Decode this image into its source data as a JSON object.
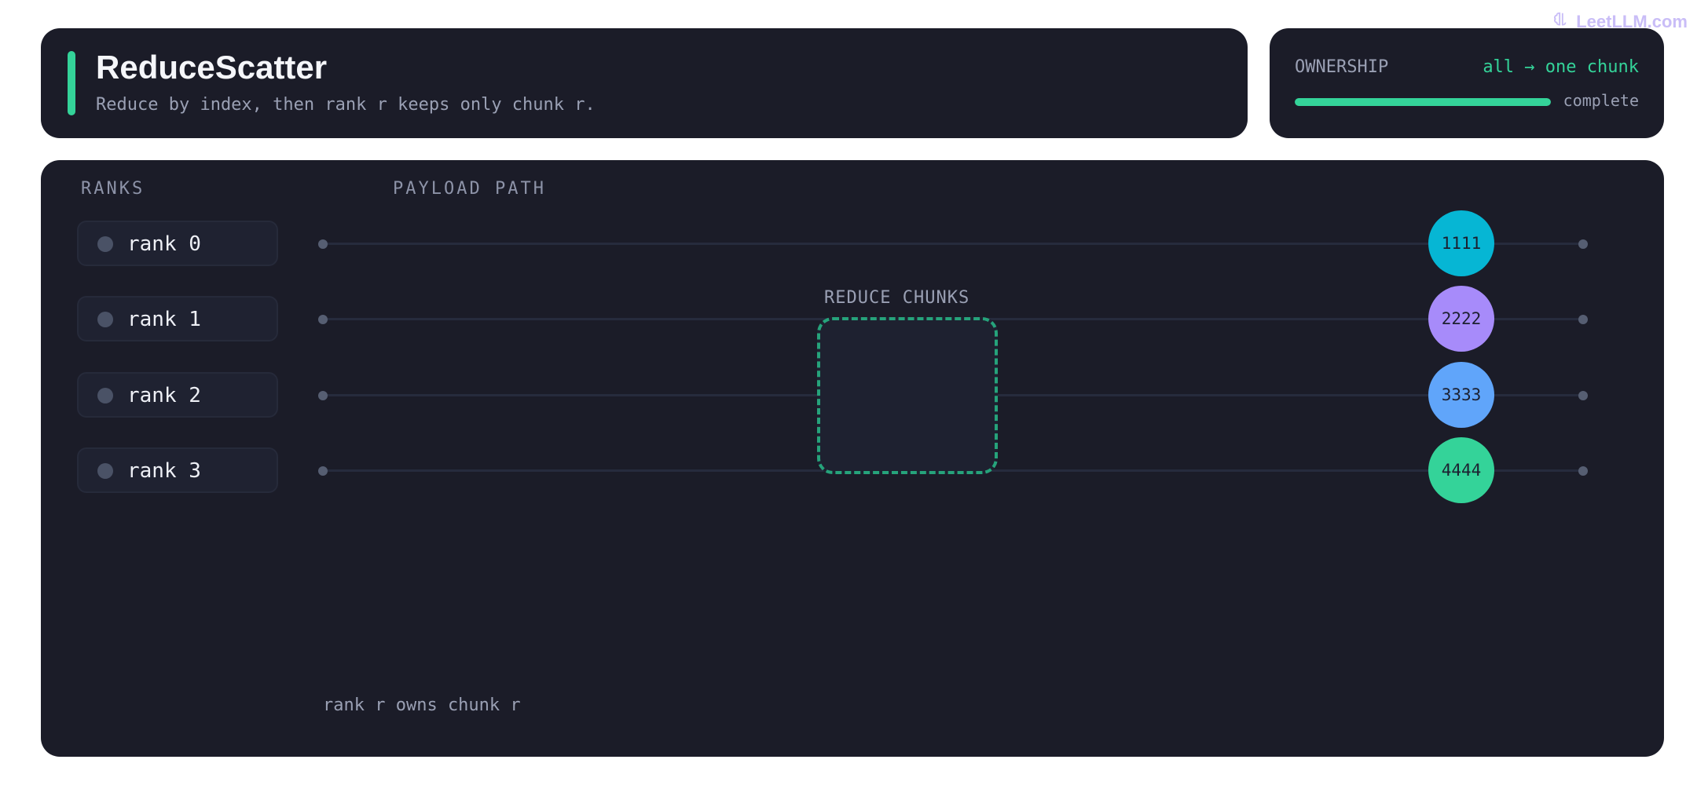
{
  "header": {
    "title": "ReduceScatter",
    "subtitle": "Reduce by index, then rank r keeps only chunk r."
  },
  "ownership": {
    "label": "OWNERSHIP",
    "value": "all → one chunk",
    "progress": 1.0,
    "status": "complete"
  },
  "brand": {
    "text": "LeetLLM.com",
    "icon": "brain-icon"
  },
  "panel": {
    "ranks_heading": "RANKS",
    "payload_heading": "PAYLOAD PATH",
    "reduce_label": "REDUCE CHUNKS",
    "footer": "rank r owns chunk r"
  },
  "ranks": [
    {
      "label": "rank 0",
      "chunk": "1111",
      "color": "#06b6d4"
    },
    {
      "label": "rank 1",
      "chunk": "2222",
      "color": "#a78bfa"
    },
    {
      "label": "rank 2",
      "chunk": "3333",
      "color": "#60a5fa"
    },
    {
      "label": "rank 3",
      "chunk": "4444",
      "color": "#34d399"
    }
  ],
  "colors": {
    "accent": "#34d399",
    "card": "#1b1c28"
  }
}
